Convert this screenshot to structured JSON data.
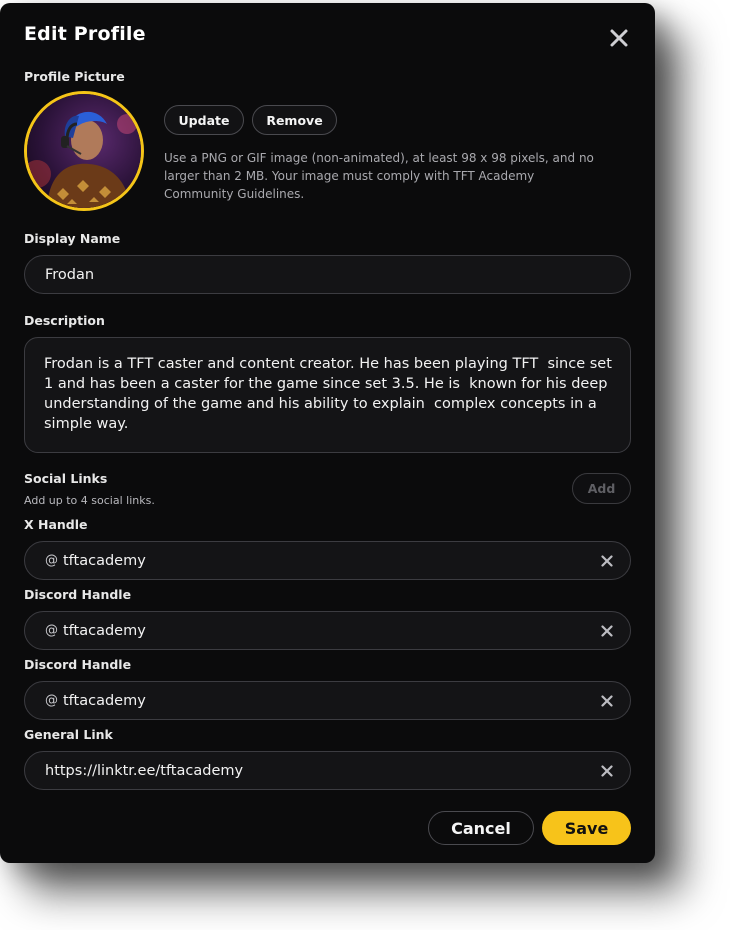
{
  "modal": {
    "title": "Edit Profile",
    "close_icon": "close-icon"
  },
  "profile_picture": {
    "label": "Profile Picture",
    "update_label": "Update",
    "remove_label": "Remove",
    "help_text": "Use a PNG or GIF image (non-animated), at least 98 x 98 pixels, and no larger than 2 MB. Your image must comply with TFT Academy Community Guidelines."
  },
  "display_name": {
    "label": "Display Name",
    "value": "Frodan"
  },
  "description": {
    "label": "Description",
    "value": "Frodan is a TFT caster and content creator. He has been playing TFT  since set 1 and has been a caster for the game since set 3.5. He is  known for his deep understanding of the game and his ability to explain  complex concepts in a simple way."
  },
  "social_links": {
    "label": "Social Links",
    "sublabel": "Add up to 4 social links.",
    "add_label": "Add",
    "items": [
      {
        "label": "X Handle",
        "prefix": "@",
        "value": "tftacademy"
      },
      {
        "label": "Discord Handle",
        "prefix": "@",
        "value": "tftacademy"
      },
      {
        "label": "Discord Handle",
        "prefix": "@",
        "value": "tftacademy"
      },
      {
        "label": "General Link",
        "prefix": "",
        "value": "https://linktr.ee/tftacademy"
      }
    ]
  },
  "actions": {
    "cancel_label": "Cancel",
    "save_label": "Save"
  },
  "colors": {
    "background": "#0b0b0c",
    "accent": "#f7c31a",
    "field_border": "#3c3c41"
  }
}
